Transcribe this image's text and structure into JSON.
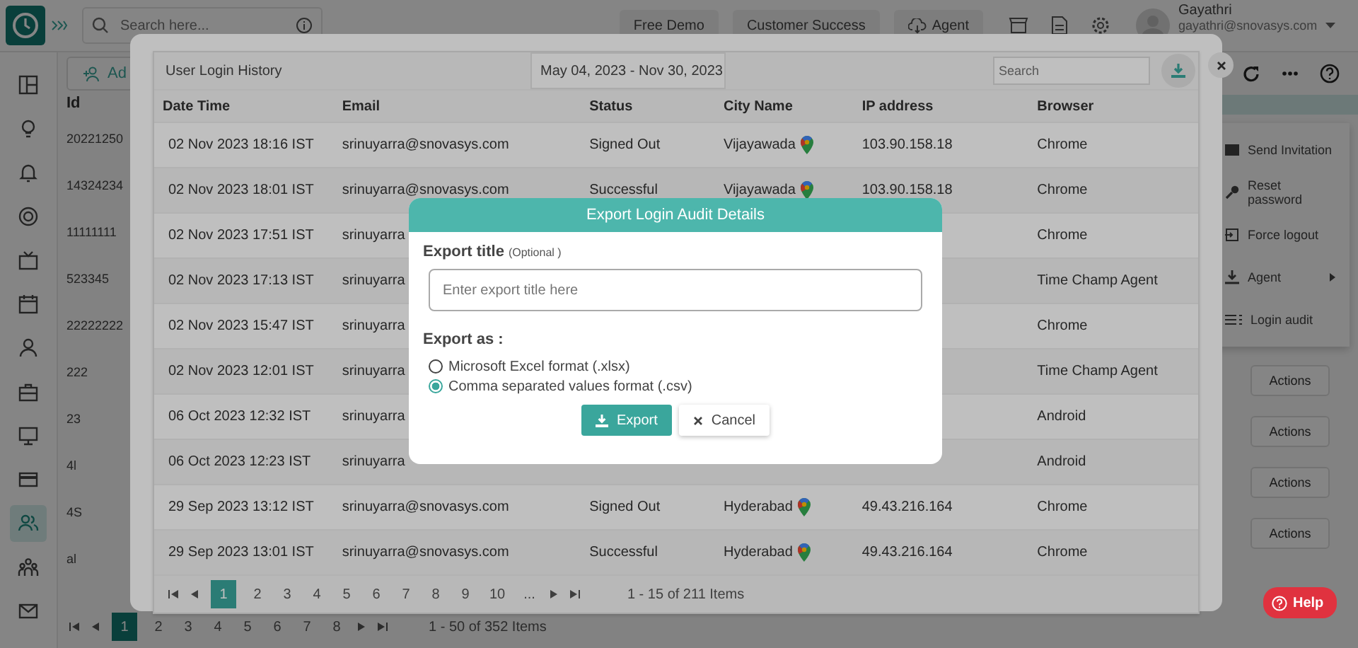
{
  "app": {
    "search": {
      "placeholder": "Search here..."
    },
    "header_buttons": [
      {
        "label": "Free Demo",
        "kind": "plain"
      },
      {
        "label": "Customer Success",
        "kind": "plain"
      },
      {
        "label": "Agent",
        "kind": "cloud"
      }
    ],
    "user": {
      "name": "Gayathri",
      "email": "gayathri@snovasys.com"
    },
    "sidebar": {
      "items": [
        {
          "selected": false
        },
        {
          "selected": false
        },
        {
          "selected": false
        },
        {
          "selected": false
        },
        {
          "selected": false
        },
        {
          "selected": false
        },
        {
          "selected": false
        },
        {
          "selected": false
        },
        {
          "selected": false
        },
        {
          "selected": false
        },
        {
          "selected": true
        },
        {
          "selected": false
        },
        {
          "selected": false
        }
      ]
    },
    "add_button": {
      "label": "Ad"
    },
    "id_column": {
      "heading": "Id",
      "rows": [
        "20221250",
        "14324234",
        "11111111",
        "523345",
        "22222222",
        "222",
        "23",
        "4l",
        "4S",
        "al"
      ]
    },
    "context_menu": {
      "items": [
        {
          "label": "Send Invitation",
          "submenu": false
        },
        {
          "label": "Reset password",
          "submenu": false
        },
        {
          "label": "Force logout",
          "submenu": false
        },
        {
          "label": "Agent",
          "submenu": true
        },
        {
          "label": "Login audit",
          "submenu": false
        }
      ]
    },
    "actions": [
      "Actions",
      "Actions",
      "Actions",
      "Actions"
    ],
    "pagination": {
      "pages": [
        {
          "label": "1",
          "selected": true
        },
        {
          "label": "2",
          "selected": false
        },
        {
          "label": "3",
          "selected": false
        },
        {
          "label": "4",
          "selected": false
        },
        {
          "label": "5",
          "selected": false
        },
        {
          "label": "6",
          "selected": false
        },
        {
          "label": "7",
          "selected": false
        },
        {
          "label": "8",
          "selected": false
        }
      ],
      "summary": "1 - 50 of 352 Items"
    }
  },
  "login_history": {
    "title": "User Login History",
    "date_range": "May 04, 2023 - Nov 30, 2023",
    "search": {
      "placeholder": "Search"
    },
    "columns": [
      "Date Time",
      "Email",
      "Status",
      "City Name",
      "IP address",
      "Browser"
    ],
    "rows": [
      {
        "date_time": "02 Nov 2023 18:16 IST",
        "email": "srinuyarra@snovasys.com",
        "status": "Signed Out",
        "city": "Vijayawada",
        "ip": "103.90.158.18",
        "browser": "Chrome"
      },
      {
        "date_time": "02 Nov 2023 18:01 IST",
        "email": "srinuyarra@snovasys.com",
        "status": "Successful",
        "city": "Vijayawada",
        "ip": "103.90.158.18",
        "browser": "Chrome"
      },
      {
        "date_time": "02 Nov 2023 17:51 IST",
        "email": "srinuyarra",
        "browser": "Chrome"
      },
      {
        "date_time": "02 Nov 2023 17:13 IST",
        "email": "srinuyarra",
        "browser": "Time Champ Agent"
      },
      {
        "date_time": "02 Nov 2023 15:47 IST",
        "email": "srinuyarra",
        "browser": "Chrome"
      },
      {
        "date_time": "02 Nov 2023 12:01 IST",
        "email": "srinuyarra",
        "browser": "Time Champ Agent"
      },
      {
        "date_time": "06 Oct 2023 12:32 IST",
        "email": "srinuyarra",
        "browser": "Android"
      },
      {
        "date_time": "06 Oct 2023 12:23 IST",
        "email": "srinuyarra",
        "browser": "Android"
      },
      {
        "date_time": "29 Sep 2023 13:12 IST",
        "email": "srinuyarra@snovasys.com",
        "status": "Signed Out",
        "city": "Hyderabad",
        "ip": "49.43.216.164",
        "browser": "Chrome"
      },
      {
        "date_time": "29 Sep 2023 13:01 IST",
        "email": "srinuyarra@snovasys.com",
        "status": "Successful",
        "city": "Hyderabad",
        "ip": "49.43.216.164",
        "browser": "Chrome"
      }
    ],
    "pagination": {
      "pages": [
        {
          "label": "1",
          "selected": true
        },
        {
          "label": "2",
          "selected": false
        },
        {
          "label": "3",
          "selected": false
        },
        {
          "label": "4",
          "selected": false
        },
        {
          "label": "5",
          "selected": false
        },
        {
          "label": "6",
          "selected": false
        },
        {
          "label": "7",
          "selected": false
        },
        {
          "label": "8",
          "selected": false
        },
        {
          "label": "9",
          "selected": false
        },
        {
          "label": "10",
          "selected": false
        },
        {
          "label": "...",
          "selected": false
        }
      ],
      "summary": "1 - 15 of 211 Items"
    }
  },
  "export_dialog": {
    "title": "Export Login Audit Details",
    "title_label": "Export title",
    "optional_note": "(Optional )",
    "input": {
      "placeholder": "Enter export title here"
    },
    "format_label": "Export as :",
    "formats": [
      {
        "label": "Microsoft Excel format (.xlsx)",
        "selected": false
      },
      {
        "label": "Comma separated values format (.csv)",
        "selected": true
      }
    ],
    "buttons": [
      {
        "label": "Export",
        "kind": "primary"
      },
      {
        "label": "Cancel",
        "kind": "secondary"
      }
    ]
  },
  "help": {
    "label": "Help"
  }
}
